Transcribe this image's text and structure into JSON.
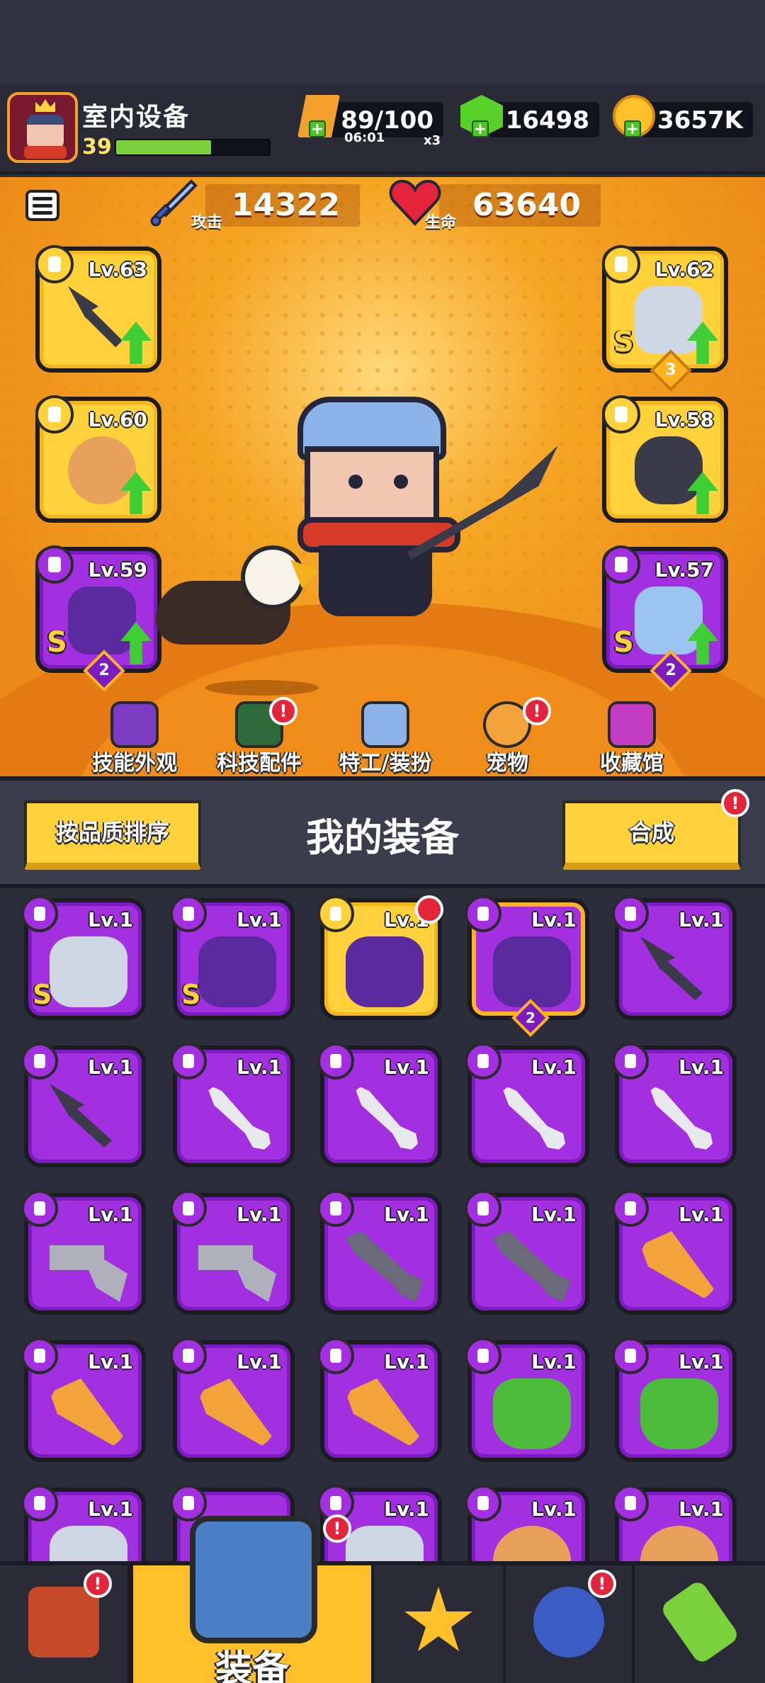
{
  "player": {
    "name": "室内设备",
    "level": "39",
    "xp_fraction": 0.62
  },
  "resources": {
    "energy": "89/100",
    "energy_timer": "06:01",
    "energy_multiplier": "x3",
    "gems": "16498",
    "coins": "3657K"
  },
  "stats": {
    "attack_value": "14322",
    "attack_label": "攻击",
    "health_value": "63640",
    "health_label": "生命"
  },
  "equipped": {
    "left": [
      {
        "level": "Lv.63",
        "rarity": "gold",
        "item": "kunai"
      },
      {
        "level": "Lv.60",
        "rarity": "gold",
        "item": "fang-necklace"
      },
      {
        "level": "Lv.59",
        "rarity": "purple",
        "item": "gauntlet",
        "grade": "S",
        "stars": "2"
      }
    ],
    "right": [
      {
        "level": "Lv.62",
        "rarity": "gold",
        "item": "armor",
        "grade": "S",
        "stars": "3"
      },
      {
        "level": "Lv.58",
        "rarity": "gold",
        "item": "belt"
      },
      {
        "level": "Lv.57",
        "rarity": "purple",
        "item": "boots",
        "grade": "S",
        "stars": "2"
      }
    ]
  },
  "categories": [
    {
      "label": "技能外观",
      "alert": false
    },
    {
      "label": "科技配件",
      "alert": true
    },
    {
      "label": "特工/装扮",
      "alert": false
    },
    {
      "label": "宠物",
      "alert": true
    },
    {
      "label": "收藏馆",
      "alert": false
    }
  ],
  "inventory": {
    "sort_label": "按品质排序",
    "title": "我的装备",
    "merge_label": "合成",
    "merge_alert": "!",
    "items": [
      {
        "level": "Lv.1",
        "art": "helm",
        "grade": "S"
      },
      {
        "level": "Lv.1",
        "art": "glove",
        "grade": "S"
      },
      {
        "level": "Lv.1",
        "art": "glove",
        "gold": true
      },
      {
        "level": "Lv.1",
        "art": "glove",
        "stars": "2",
        "selected": true
      },
      {
        "level": "Lv.1",
        "art": "knife"
      },
      {
        "level": "Lv.1",
        "art": "knife"
      },
      {
        "level": "Lv.1",
        "art": "sword"
      },
      {
        "level": "Lv.1",
        "art": "sword"
      },
      {
        "level": "Lv.1",
        "art": "sword"
      },
      {
        "level": "Lv.1",
        "art": "sword"
      },
      {
        "level": "Lv.1",
        "art": "gun"
      },
      {
        "level": "Lv.1",
        "art": "gun"
      },
      {
        "level": "Lv.1",
        "art": "shotgun"
      },
      {
        "level": "Lv.1",
        "art": "shotgun"
      },
      {
        "level": "Lv.1",
        "art": "torch"
      },
      {
        "level": "Lv.1",
        "art": "torch"
      },
      {
        "level": "Lv.1",
        "art": "torch"
      },
      {
        "level": "Lv.1",
        "art": "torch"
      },
      {
        "level": "Lv.1",
        "art": "armor"
      },
      {
        "level": "Lv.1",
        "art": "armor"
      },
      {
        "level": "Lv.1",
        "art": "helm"
      },
      {
        "level": "",
        "art": "helm"
      },
      {
        "level": "Lv.1",
        "art": "helm"
      },
      {
        "level": "Lv.1",
        "art": "bracelet"
      },
      {
        "level": "Lv.1",
        "art": "bracelet"
      }
    ]
  },
  "tabbar": {
    "equip_label": "装备",
    "tabs": [
      "shop",
      "equip",
      "battle",
      "talent",
      "dna"
    ]
  },
  "colors": {
    "gold": "#ffd23b",
    "purple": "#a22fe0",
    "alert": "#e3243b",
    "stage_orange": "#f5a524"
  }
}
